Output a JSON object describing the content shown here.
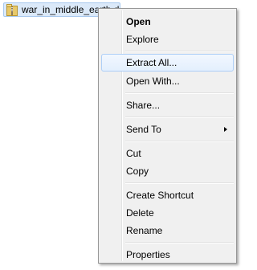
{
  "file": {
    "name": "war_in_middle_earth.d",
    "icon": "folder-zip-icon"
  },
  "menu": {
    "items": [
      {
        "label": "Open"
      },
      {
        "label": "Explore"
      },
      {
        "label": "Extract All..."
      },
      {
        "label": "Open With..."
      },
      {
        "label": "Share..."
      },
      {
        "label": "Send To"
      },
      {
        "label": "Cut"
      },
      {
        "label": "Copy"
      },
      {
        "label": "Create Shortcut"
      },
      {
        "label": "Delete"
      },
      {
        "label": "Rename"
      },
      {
        "label": "Properties"
      }
    ]
  },
  "colors": {
    "hover_bg": "#e3effd",
    "selection_bg": "#dbe9f9",
    "menu_bg": "#f0f0f0"
  }
}
